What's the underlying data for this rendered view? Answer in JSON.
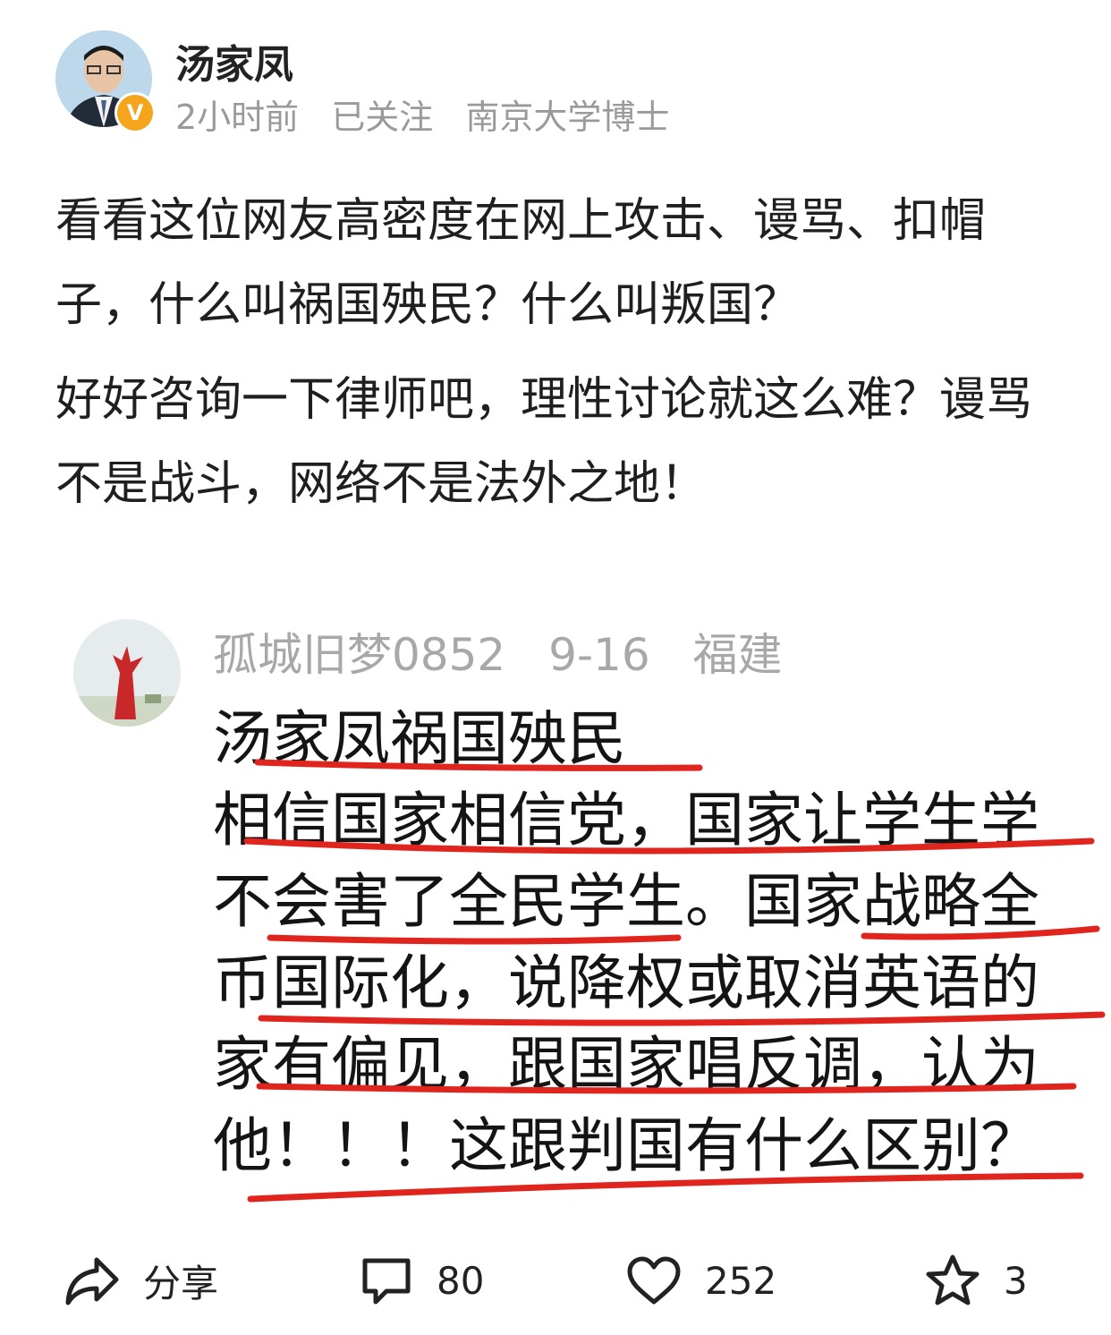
{
  "post": {
    "author": "汤家凤",
    "time": "2小时前",
    "follow_status": "已关注",
    "title_tag": "南京大学博士",
    "verified_badge": "V",
    "paragraphs": [
      "看看这位网友高密度在网上攻击、谩骂、扣帽子，什么叫祸国殃民？什么叫叛国？",
      "好好咨询一下律师吧，理性讨论就这么难？谩骂不是战斗，网络不是法外之地！"
    ]
  },
  "embedded_comment": {
    "username": "孤城旧梦0852",
    "date": "9-16",
    "location": "福建",
    "lines": [
      "汤家凤祸国殃民",
      "相信国家相信党，国家让学生学",
      "不会害了全民学生。国家战略全",
      "币国际化，说降权或取消英语的",
      "家有偏见，跟国家唱反调，认为",
      "他！！！这跟判国有什么区别？"
    ],
    "underline_color": "#e0251f"
  },
  "actions": {
    "share_label": "分享",
    "comments_count": "80",
    "likes_count": "252",
    "favorites_count": "3"
  },
  "icons": [
    "share-icon",
    "comment-icon",
    "like-icon",
    "favorite-icon"
  ],
  "colors": {
    "meta_gray": "#9a9a9a",
    "badge": "#f4a51c"
  }
}
